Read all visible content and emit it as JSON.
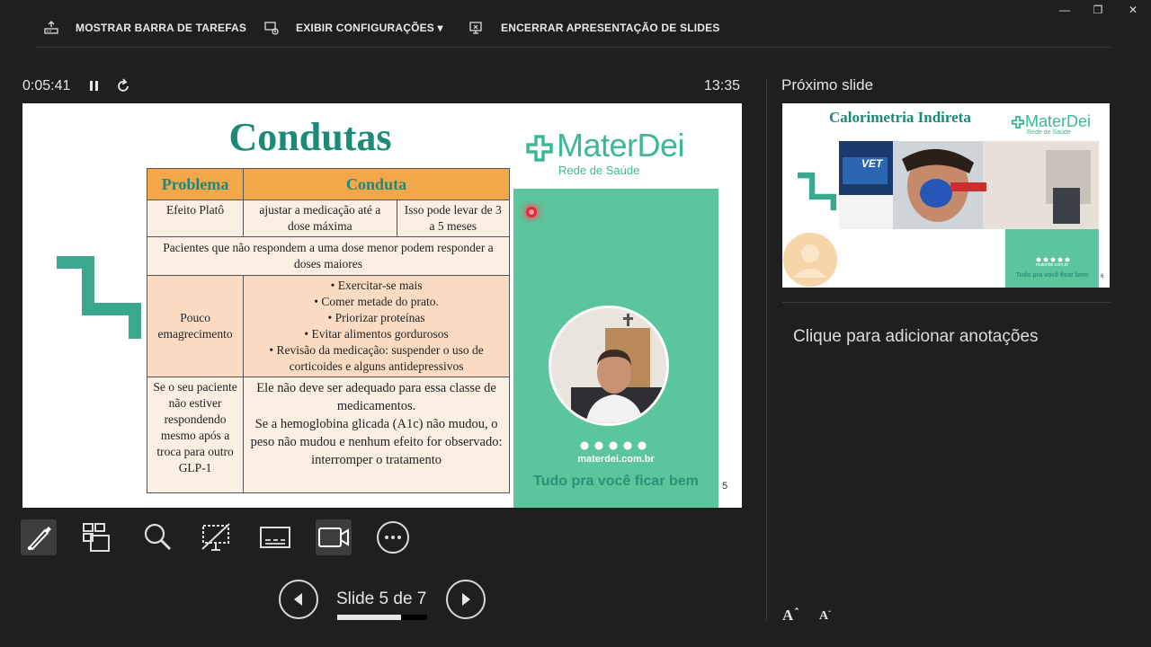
{
  "toolbar": {
    "show_taskbar": "MOSTRAR BARRA DE TAREFAS",
    "display_settings": "EXIBIR CONFIGURAÇÕES ▾",
    "end_show": "ENCERRAR APRESENTAÇÃO DE SLIDES"
  },
  "window": {
    "minimize": "—",
    "restore": "❐",
    "close": "✕"
  },
  "timer": {
    "elapsed": "0:05:41",
    "clock": "13:35"
  },
  "slide": {
    "title": "Condutas",
    "logo_name": "MaterDei",
    "logo_sub": "Rede de Saúde",
    "site": "materdei.com.br",
    "tagline": "Tudo pra você ficar bem",
    "page_number": "5",
    "table": {
      "headers": [
        "Problema",
        "Conduta"
      ],
      "row1": {
        "problem": "Efeito Platô",
        "action": "ajustar a medicação até a dose máxima",
        "note": "Isso pode levar de 3 a 5 meses"
      },
      "row2": "Pacientes que não respondem a uma dose menor podem responder a doses maiores",
      "row3": {
        "problem": "Pouco emagrecimento",
        "items": [
          "Exercitar-se mais",
          "Comer metade do prato.",
          "Priorizar proteínas",
          "Evitar alimentos gordurosos",
          "Revisão da medicação: suspender o uso de corticoides e alguns antidepressivos"
        ]
      },
      "row4": {
        "problem": "Se o seu paciente não estiver respondendo mesmo após a troca para outro GLP-1",
        "action_1": "Ele não deve ser adequado para essa classe de medicamentos.",
        "action_2": "Se a hemoglobina glicada (A1c) não mudou, o peso não mudou e nenhum efeito for observado: interromper o tratamento"
      }
    }
  },
  "navigation": {
    "slide_counter": "Slide 5 de 7",
    "progress": 0.714
  },
  "next_slide": {
    "label": "Próximo slide",
    "title": "Calorimetria Indireta",
    "logo_name": "MaterDei",
    "logo_sub": "Rede de Saúde",
    "site": "materdei.com.br",
    "tagline": "Tudo pra você ficar bem",
    "page_number": "6",
    "photo_text": "VET"
  },
  "notes": {
    "placeholder": "Clique para adicionar anotações"
  },
  "font_controls": {
    "increase": "A",
    "decrease": "A"
  },
  "colors": {
    "brand_green": "#1d8a78",
    "panel_green": "#5bc59c",
    "header_orange": "#f4a64a"
  },
  "icons": [
    "taskbar-icon",
    "display-settings-icon",
    "end-show-icon",
    "pause-icon",
    "reset-icon",
    "pen-icon",
    "all-slides-icon",
    "zoom-icon",
    "black-screen-icon",
    "subtitles-icon",
    "camera-icon",
    "more-icon",
    "previous-icon",
    "next-icon"
  ]
}
